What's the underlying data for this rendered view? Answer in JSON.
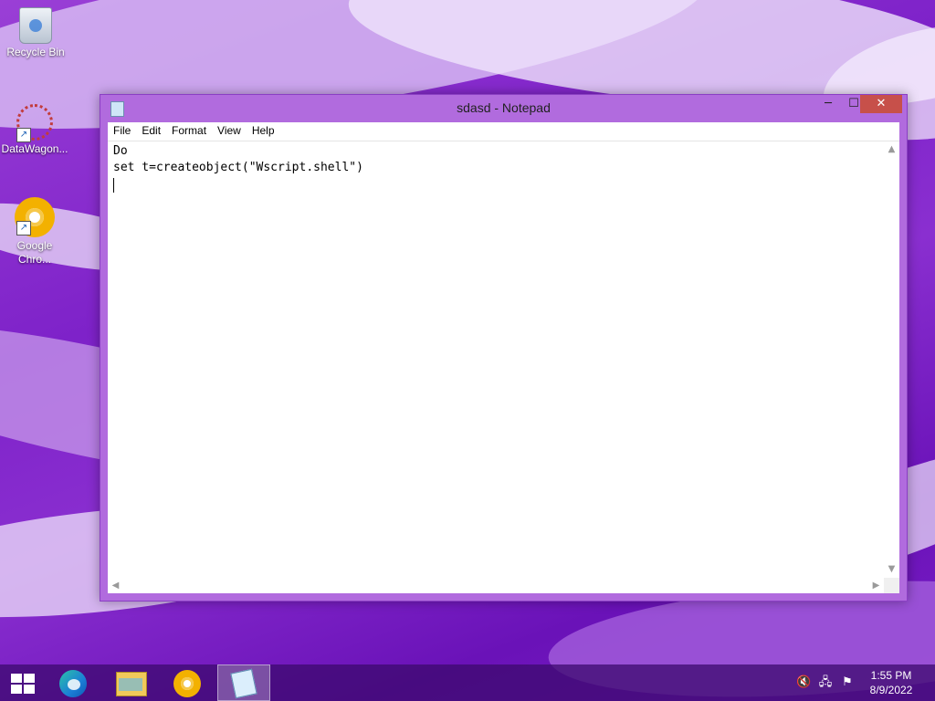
{
  "desktop": {
    "icons": [
      {
        "label": "Recycle Bin"
      },
      {
        "label": "DataWagon..."
      },
      {
        "label": "Google Chro..."
      }
    ]
  },
  "window": {
    "title": "sdasd - Notepad",
    "controls": {
      "minimize": "─",
      "maximize": "☐",
      "close": "✕"
    },
    "menu": [
      "File",
      "Edit",
      "Format",
      "View",
      "Help"
    ],
    "text_lines": [
      "Do",
      "set t=createobject(\"Wscript.shell\")"
    ]
  },
  "taskbar": {
    "apps": [
      {
        "name": "start-icon"
      },
      {
        "name": "edge-icon"
      },
      {
        "name": "file-explorer-icon"
      },
      {
        "name": "chrome-icon"
      },
      {
        "name": "notepad-icon",
        "active": true
      }
    ],
    "tray": {
      "volume_icon": "🔇",
      "network_icon": "🖧",
      "flag_icon": "⚑",
      "time": "1:55 PM",
      "date": "8/9/2022"
    }
  }
}
